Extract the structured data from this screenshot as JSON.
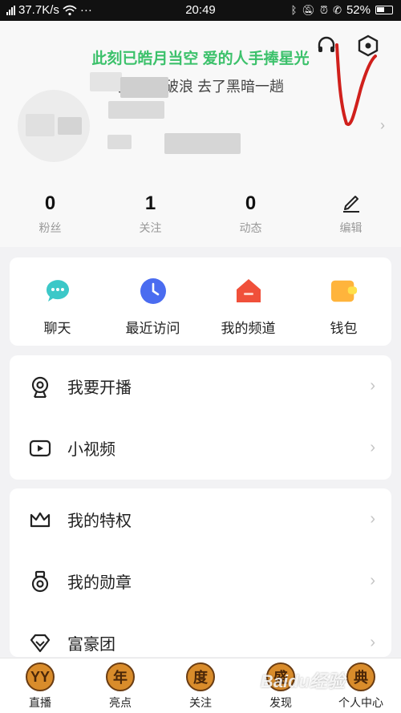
{
  "status_bar": {
    "network_speed": "37.7K/s",
    "time": "20:49",
    "battery": "52%"
  },
  "header": {
    "lyric_line1": "此刻已皓月当空 爱的人手捧星光",
    "lyric_line2": "我 乘风破浪 去了黑暗一趟",
    "icons": [
      "headset-icon",
      "settings-hexagon-icon"
    ]
  },
  "stats": [
    {
      "value": "0",
      "label": "粉丝"
    },
    {
      "value": "1",
      "label": "关注"
    },
    {
      "value": "0",
      "label": "动态"
    },
    {
      "value": "",
      "label": "编辑"
    }
  ],
  "quick_actions": [
    {
      "label": "聊天",
      "icon": "chat-bubble-icon",
      "color": "#3cc8c8"
    },
    {
      "label": "最近访问",
      "icon": "clock-icon",
      "color": "#4a6cf0"
    },
    {
      "label": "我的频道",
      "icon": "home-channel-icon",
      "color": "#f0503a"
    },
    {
      "label": "钱包",
      "icon": "wallet-icon",
      "color": "#ffb43c"
    }
  ],
  "menu_group1": [
    {
      "label": "我要开播",
      "icon": "camera-icon"
    },
    {
      "label": "小视频",
      "icon": "video-play-icon"
    }
  ],
  "menu_group2": [
    {
      "label": "我的特权",
      "icon": "crown-icon"
    },
    {
      "label": "我的勋章",
      "icon": "medal-icon"
    },
    {
      "label": "富豪团",
      "icon": "diamond-icon"
    }
  ],
  "bottom_nav": [
    {
      "label": "直播",
      "badge": "YY"
    },
    {
      "label": "亮点",
      "badge": "年"
    },
    {
      "label": "关注",
      "badge": "度"
    },
    {
      "label": "发现",
      "badge": "盛"
    },
    {
      "label": "个人中心",
      "badge": "典"
    }
  ],
  "watermark": "Baidu经验",
  "colors": {
    "accent_green": "#3cc16b",
    "annotation_red": "#d0201c"
  }
}
